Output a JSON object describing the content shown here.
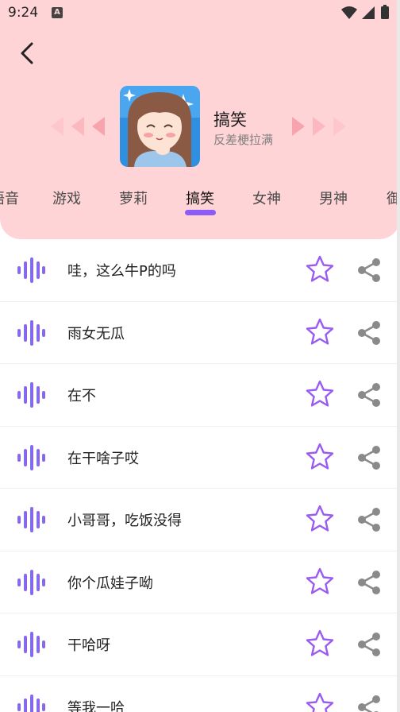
{
  "status_bar": {
    "time": "9:24",
    "notification_letter": "A"
  },
  "category": {
    "title": "搞笑",
    "subtitle": "反差梗拉满"
  },
  "tabs": [
    {
      "label": "语音",
      "active": false
    },
    {
      "label": "游戏",
      "active": false
    },
    {
      "label": "萝莉",
      "active": false
    },
    {
      "label": "搞笑",
      "active": true
    },
    {
      "label": "女神",
      "active": false
    },
    {
      "label": "男神",
      "active": false
    },
    {
      "label": "御",
      "active": false
    }
  ],
  "items": [
    {
      "text": "哇，这么牛P的吗"
    },
    {
      "text": "雨女无瓜"
    },
    {
      "text": "在不"
    },
    {
      "text": "在干啥子哎"
    },
    {
      "text": "小哥哥，吃饭没得"
    },
    {
      "text": "你个瓜娃子呦"
    },
    {
      "text": "干哈呀"
    },
    {
      "text": "等我一哈"
    }
  ],
  "colors": {
    "header_bg": "#ffd4d6",
    "accent": "#8b5cf6",
    "arrow_pink": "#f7a1ad",
    "icon_gray": "#8a8a8a"
  },
  "icons": {
    "back": "chevron-left-icon",
    "item": "sound-wave-icon",
    "favorite": "star-outline-icon",
    "share": "share-icon"
  }
}
